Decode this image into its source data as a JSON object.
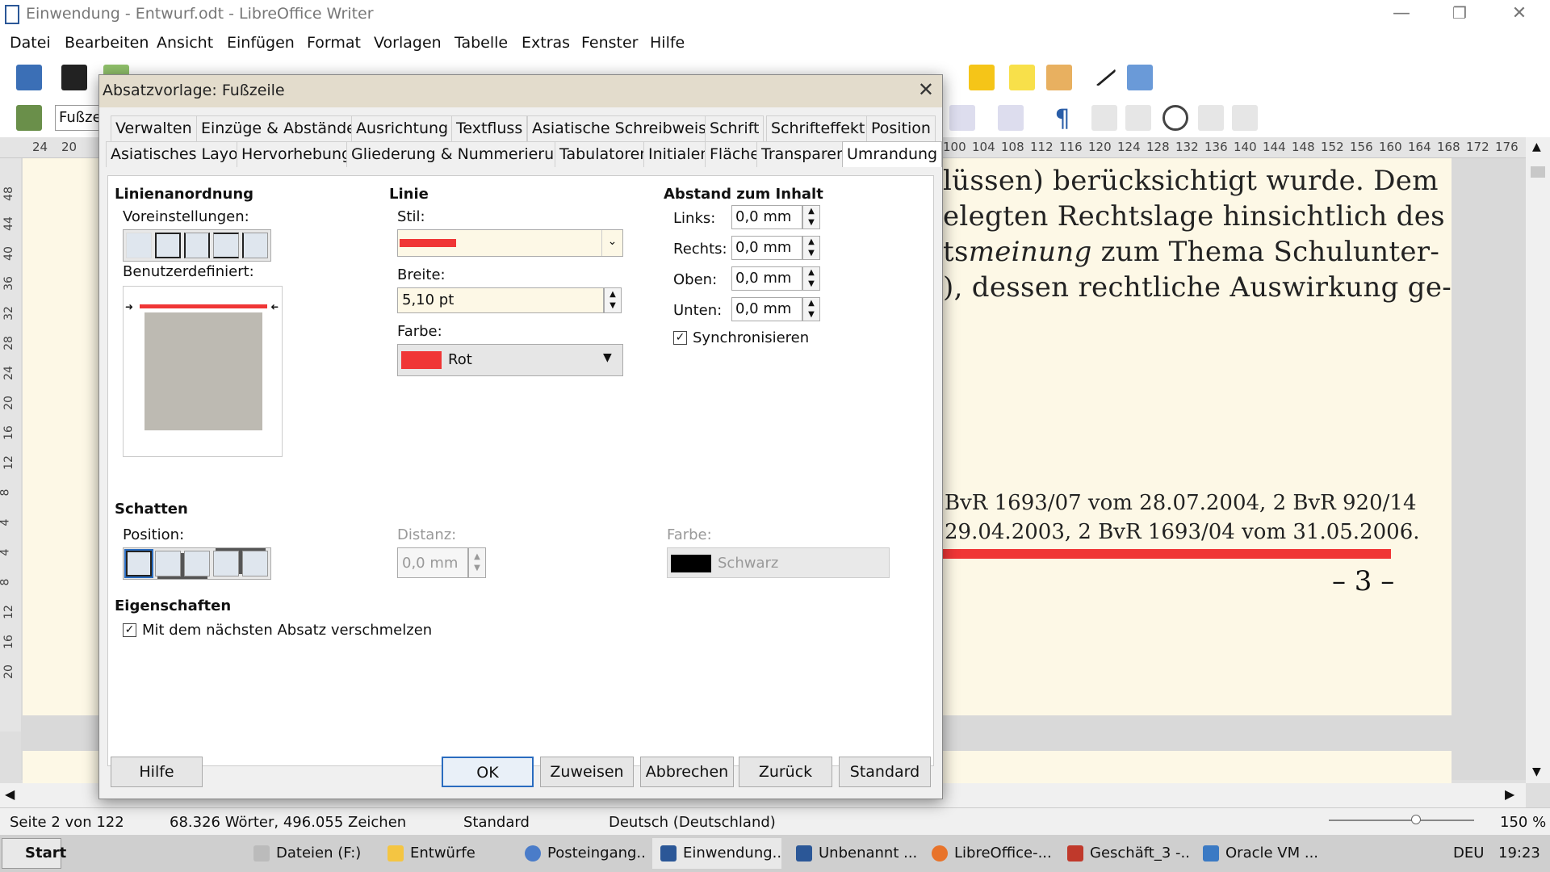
{
  "window": {
    "title": "Einwendung - Entwurf.odt - LibreOffice Writer",
    "minimize": "—",
    "restore": "❐",
    "close": "✕"
  },
  "menu": [
    "Datei",
    "Bearbeiten",
    "Ansicht",
    "Einfügen",
    "Format",
    "Vorlagen",
    "Tabelle",
    "Extras",
    "Fenster",
    "Hilfe"
  ],
  "toolbar": {
    "paragraph_style": "Fußze"
  },
  "ruler": {
    "h_left": [
      "24",
      "20"
    ],
    "h_right": [
      "100",
      "104",
      "108",
      "112",
      "116",
      "120",
      "124",
      "128",
      "132",
      "136",
      "140",
      "144",
      "148",
      "152",
      "156",
      "160",
      "164",
      "168",
      "172",
      "176"
    ],
    "v": [
      "48",
      "44",
      "40",
      "36",
      "32",
      "28",
      "24",
      "20",
      "16",
      "12",
      "8",
      "4",
      "4",
      "8",
      "12",
      "16",
      "20"
    ]
  },
  "document": {
    "lines": [
      "lüssen) berücksichtigt wurde. Dem",
      "elegten Rechtslage hinsichtlich des",
      "tsmeinung zum Thema Schulunter-",
      "), dessen rechtliche Auswirkung ge-"
    ],
    "line3_italic": "meinung",
    "footer_lines": [
      "BvR 1693/07 vom 28.07.2004, 2 BvR 920/14",
      "29.04.2003, 2 BvR 1693/04 vom 31.05.2006."
    ],
    "page_number": "– 3 –"
  },
  "dialog": {
    "title": "Absatzvorlage: Fußzeile",
    "tabs_row1": [
      "Verwalten",
      "Einzüge & Abstände",
      "Ausrichtung",
      "Textfluss",
      "Asiatische Schreibweise",
      "Schrift",
      "Schrifteffekt",
      "Position"
    ],
    "tabs_row2": [
      "Asiatisches Layout",
      "Hervorhebung",
      "Gliederung & Nummerierung",
      "Tabulatoren",
      "Initialen",
      "Fläche",
      "Transparenz",
      "Umrandung"
    ],
    "active_tab": "Umrandung",
    "line_arrangement": {
      "heading": "Linienanordnung",
      "presets_label": "Voreinstellungen:",
      "custom_label": "Benutzerdefiniert:"
    },
    "line": {
      "heading": "Linie",
      "style_label": "Stil:",
      "width_label": "Breite:",
      "width_value": "5,10 pt",
      "color_label": "Farbe:",
      "color_value": "Rot",
      "color_hex": "#f03636"
    },
    "padding": {
      "heading": "Abstand zum Inhalt",
      "left_label": "Links:",
      "left_value": "0,0 mm",
      "right_label": "Rechts:",
      "right_value": "0,0 mm",
      "top_label": "Oben:",
      "top_value": "0,0 mm",
      "bottom_label": "Unten:",
      "bottom_value": "0,0 mm",
      "sync_label": "Synchronisieren",
      "sync_checked": true
    },
    "shadow": {
      "heading": "Schatten",
      "position_label": "Position:",
      "distance_label": "Distanz:",
      "distance_value": "0,0 mm",
      "color_label": "Farbe:",
      "color_value": "Schwarz"
    },
    "properties": {
      "heading": "Eigenschaften",
      "merge_label": "Mit dem nächsten Absatz verschmelzen",
      "merge_checked": true
    },
    "buttons": {
      "help": "Hilfe",
      "ok": "OK",
      "apply": "Zuweisen",
      "cancel": "Abbrechen",
      "back": "Zurück",
      "default": "Standard"
    }
  },
  "statusbar": {
    "page": "Seite 2 von 122",
    "words": "68.326 Wörter, 496.055 Zeichen",
    "page_style": "Standard",
    "language": "Deutsch (Deutschland)",
    "zoom": "150 %"
  },
  "taskbar": {
    "start": "Start",
    "tasks": [
      "Dateien (F:)",
      "Entwürfe",
      "Posteingang...",
      "Einwendung...",
      "Unbenannt ...",
      "LibreOffice-...",
      "Geschäft_3 -...",
      "Oracle VM ..."
    ],
    "active_task": "Einwendung...",
    "lang": "DEU",
    "time": "19:23"
  }
}
